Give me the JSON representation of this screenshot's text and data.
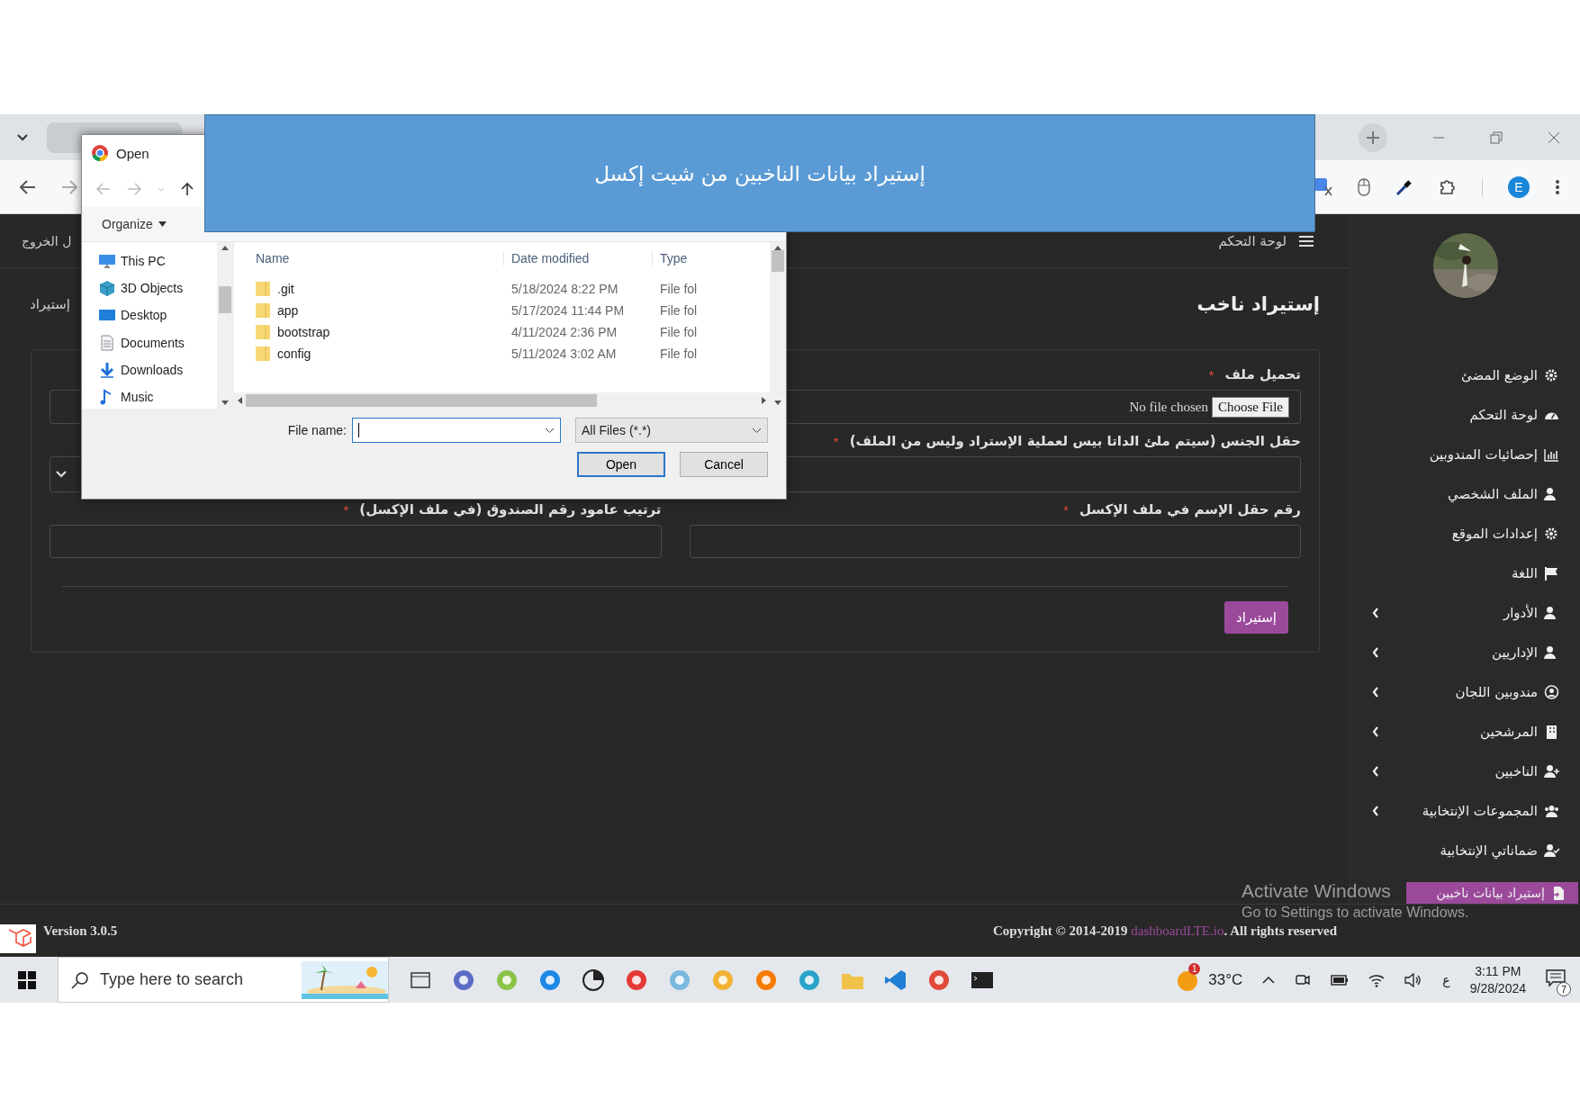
{
  "browser": {
    "profile_initial": "E"
  },
  "banner": {
    "text": "إستيراد بيانات الناخبين من شيت إكسل"
  },
  "page": {
    "logout": "ل الخروج",
    "dashboard_link": "لوحة التحكم",
    "title": "إستيراد ناخب",
    "breadcrumb": "إستيراد"
  },
  "form": {
    "fields": [
      {
        "kind": "file",
        "label": "تحميل ملف",
        "required_mark": "*",
        "status": "No file chosen",
        "button": "Choose File"
      },
      {
        "kind": "select",
        "label": "حقل الجنس (سيتم ملئ الداتا بيس لعملية الإستراد وليس من الملف)",
        "required_mark": "*"
      },
      {
        "kind": "text",
        "label": "رقم حقل الإسم في ملف الإكسل",
        "required_mark": "*"
      },
      {
        "kind": "text",
        "label": "ترتيب عامود رقم الصندوق (في ملف الإكسل)",
        "required_mark": "*"
      }
    ],
    "submit": "إستيراد"
  },
  "sidebar": {
    "items": [
      {
        "label": "الوضع المضئ",
        "expandable": false,
        "selected": false
      },
      {
        "label": "لوحة التحكم",
        "expandable": false,
        "selected": false
      },
      {
        "label": "إحصائيات المندوبين",
        "expandable": false,
        "selected": false
      },
      {
        "label": "الملف الشخصي",
        "expandable": false,
        "selected": false
      },
      {
        "label": "إعدادات الموقع",
        "expandable": false,
        "selected": false
      },
      {
        "label": "اللغة",
        "expandable": false,
        "selected": false
      },
      {
        "label": "الأدوار",
        "expandable": true,
        "selected": false
      },
      {
        "label": "الإداريين",
        "expandable": true,
        "selected": false
      },
      {
        "label": "مندوبين اللجان",
        "expandable": true,
        "selected": false
      },
      {
        "label": "المرشحين",
        "expandable": true,
        "selected": false
      },
      {
        "label": "الناخبين",
        "expandable": true,
        "selected": false
      },
      {
        "label": "المجموعات الإنتخابية",
        "expandable": true,
        "selected": false
      },
      {
        "label": "ضماناتي الإنتخابية",
        "expandable": false,
        "selected": false
      },
      {
        "label": "إستيراد بيانات ناخبين",
        "expandable": false,
        "selected": true
      }
    ]
  },
  "footer": {
    "version": "Version 3.0.5",
    "copyright": "Copyright © 2014-2019",
    "link": "dashboardLTE.io",
    "rights": ". All rights reserved"
  },
  "dialog": {
    "title": "Open",
    "organize": "Organize",
    "tree": [
      "This PC",
      "3D Objects",
      "Desktop",
      "Documents",
      "Downloads",
      "Music"
    ],
    "column_headers": {
      "name": "Name",
      "date": "Date modified",
      "type": "Type"
    },
    "files": [
      {
        "name": ".git",
        "date": "5/18/2024 8:22 PM",
        "type": "File fol"
      },
      {
        "name": "app",
        "date": "5/17/2024 11:44 PM",
        "type": "File fol"
      },
      {
        "name": "bootstrap",
        "date": "4/11/2024 2:36 PM",
        "type": "File fol"
      },
      {
        "name": "config",
        "date": "5/11/2024 3:02 AM",
        "type": "File fol"
      }
    ],
    "file_name_label": "File name:",
    "file_type": "All Files (*.*)",
    "open_button": {
      "label": "Open",
      "default": true
    },
    "cancel_button": {
      "label": "Cancel",
      "default": false
    }
  },
  "os_watermark": {
    "title": "Activate Windows",
    "subtitle": "Go to Settings to activate Windows."
  },
  "taskbar": {
    "search_placeholder": "Type here to search",
    "weather_badge": "1",
    "weather": "33°C",
    "language": "ع",
    "time": "3:11 PM",
    "date": "9/28/2024",
    "notifications": "7"
  }
}
